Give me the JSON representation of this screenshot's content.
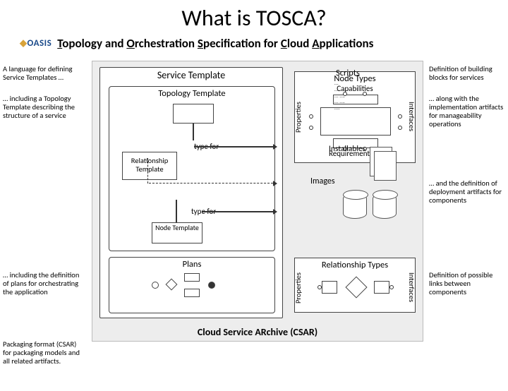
{
  "title": "What is TOSCA?",
  "brand": {
    "oasis": "OASIS"
  },
  "acronym": {
    "t": "T",
    "opology": "opology and ",
    "o": "O",
    "rchestration": "rchestration ",
    "s": "S",
    "pecification": "pecification for ",
    "c": "C",
    "loud": "loud ",
    "a": "A",
    "pplications": "pplications"
  },
  "left": {
    "lang": "A language for defining Service Templates …",
    "topo": "… including a Topology Template describing the structure of a service",
    "plans": "… including the definition of plans for orchestrating the application",
    "csar": "Packaging format (CSAR) for packaging models and all related artifacts."
  },
  "right": {
    "bb": "Definition of building blocks for services",
    "impl": "… along with the implementation artifacts for manageability operations",
    "deploy": "… and the definition of deployment artifacts for components",
    "links": "Definition of possible links between components"
  },
  "svc": {
    "hdr": "Service Template"
  },
  "topo": {
    "hdr": "Topology Template",
    "rel": "Relationship Template",
    "node": "Node Template",
    "typefor": "type for"
  },
  "plans": {
    "hdr": "Plans"
  },
  "nodetypes": {
    "hdr": "Node Types",
    "cap": "Capabilities",
    "req": "Requirements",
    "props": "Properties",
    "ifaces": "Interfaces"
  },
  "reltypes": {
    "hdr": "Relationship Types",
    "props": "Properties",
    "ifaces": "Interfaces"
  },
  "artifacts": {
    "scripts": "Scripts",
    "installables": "Installables",
    "images": "Images",
    "scriptlines": "…\n… ….\n… ….\n… ….\n…."
  },
  "csar": {
    "title": "Cloud Service ARchive (CSAR)"
  }
}
